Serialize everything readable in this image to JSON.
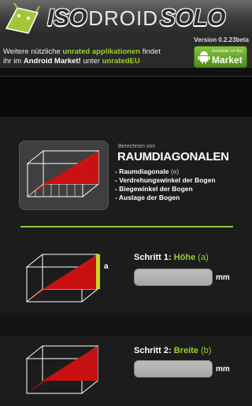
{
  "header": {
    "logo_left": "ISO",
    "logo_mid": "DROID",
    "logo_right": "SOLO",
    "version": "Version 0.2.23beta"
  },
  "info": {
    "part1": "Weitere nützliche ",
    "highlight1": "unrated applikationen",
    "part2": " findet",
    "part3": "ihr im ",
    "bold1": "Android Market!",
    "part4": " unter ",
    "highlight2": "unratedEU"
  },
  "market_button": {
    "small": "Available on the",
    "big": "Market"
  },
  "hero": {
    "subtitle": "Berechnen von",
    "title": "RAUMDIAGONALEN",
    "items": [
      {
        "label": "- Raumdiagonale ",
        "suffix": "(e)"
      },
      {
        "label": "- Verdrehungswinkel der Bogen",
        "suffix": ""
      },
      {
        "label": "- Biegewinkel der Bogen",
        "suffix": ""
      },
      {
        "label": "- Auslage der Bogen",
        "suffix": ""
      }
    ]
  },
  "steps": [
    {
      "prefix": "Schritt 1: ",
      "name": "Höhe",
      "symbol": " (a)",
      "unit": "mm",
      "marker": "a",
      "value": ""
    },
    {
      "prefix": "Schritt 2: ",
      "name": "Breite",
      "symbol": " (b)",
      "unit": "mm",
      "value": ""
    }
  ],
  "colors": {
    "accent": "#9bcf2c",
    "red": "#cc1010",
    "background": "#111111"
  }
}
